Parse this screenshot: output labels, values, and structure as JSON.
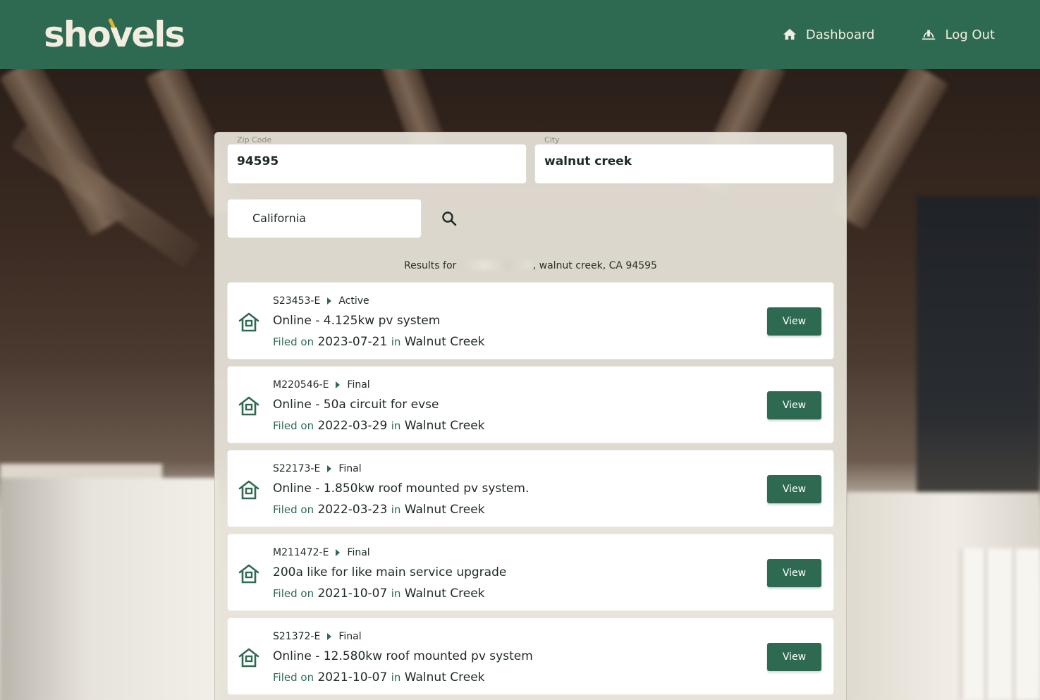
{
  "header": {
    "logo_text": "shovels",
    "nav": [
      {
        "label": "Dashboard",
        "icon": "home-icon"
      },
      {
        "label": "Log Out",
        "icon": "hard-hat-icon"
      }
    ]
  },
  "search": {
    "zip_label": "Zip Code",
    "zip_value": "94595",
    "city_label": "City",
    "city_value": "walnut creek",
    "state_value": "California",
    "search_icon": "search-icon"
  },
  "results": {
    "prefix": "Results for",
    "suffix": ", walnut creek,  CA 94595"
  },
  "permits": [
    {
      "id": "S23453-E",
      "status": "Active",
      "title": "Online - 4.125kw pv system",
      "filed_label": "Filed on",
      "date": "2023-07-21",
      "in_label": "in",
      "city": "Walnut Creek",
      "button": "View"
    },
    {
      "id": "M220546-E",
      "status": "Final",
      "title": "Online - 50a circuit for evse",
      "filed_label": "Filed on",
      "date": "2022-03-29",
      "in_label": "in",
      "city": "Walnut Creek",
      "button": "View"
    },
    {
      "id": "S22173-E",
      "status": "Final",
      "title": "Online - 1.850kw roof mounted pv system.",
      "filed_label": "Filed on",
      "date": "2022-03-23",
      "in_label": "in",
      "city": "Walnut Creek",
      "button": "View"
    },
    {
      "id": "M211472-E",
      "status": "Final",
      "title": "200a like for like main service upgrade",
      "filed_label": "Filed on",
      "date": "2021-10-07",
      "in_label": "in",
      "city": "Walnut Creek",
      "button": "View"
    },
    {
      "id": "S21372-E",
      "status": "Final",
      "title": "Online - 12.580kw roof mounted pv system",
      "filed_label": "Filed on",
      "date": "2021-10-07",
      "in_label": "in",
      "city": "Walnut Creek",
      "button": "View"
    }
  ],
  "colors": {
    "brand_green": "#2e6a52",
    "logo_accent": "#e0b52e",
    "panel_bg": "#e8e4da"
  }
}
